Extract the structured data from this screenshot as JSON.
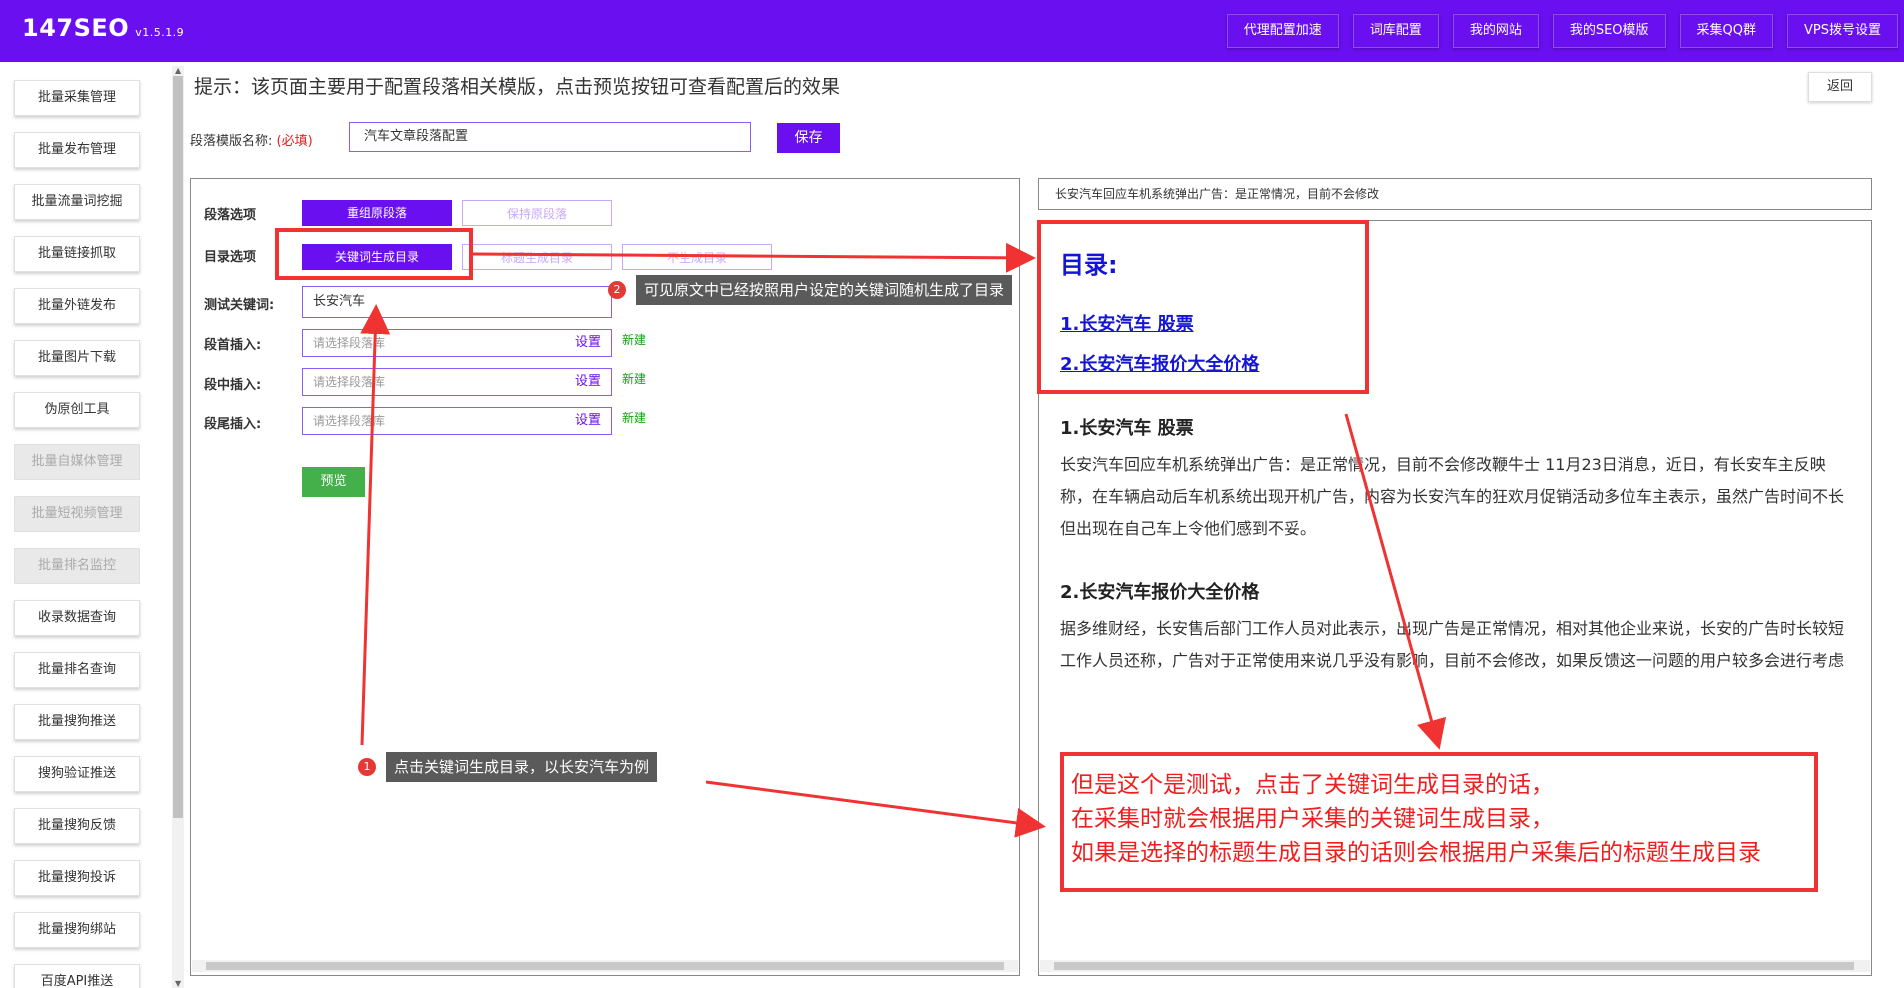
{
  "app": {
    "title": "147SEO",
    "version": "v1.5.1.9"
  },
  "topnav": [
    "代理配置加速",
    "词库配置",
    "我的网站",
    "我的SEO模版",
    "采集QQ群",
    "VPS拨号设置"
  ],
  "sidebar": {
    "items": [
      {
        "label": "批量采集管理",
        "disabled": false
      },
      {
        "label": "批量发布管理",
        "disabled": false
      },
      {
        "label": "批量流量词挖掘",
        "disabled": false
      },
      {
        "label": "批量链接抓取",
        "disabled": false
      },
      {
        "label": "批量外链发布",
        "disabled": false
      },
      {
        "label": "批量图片下载",
        "disabled": false
      },
      {
        "label": "伪原创工具",
        "disabled": false
      },
      {
        "label": "批量自媒体管理",
        "disabled": true
      },
      {
        "label": "批量短视频管理",
        "disabled": true
      },
      {
        "label": "批量排名监控",
        "disabled": true
      },
      {
        "label": "收录数据查询",
        "disabled": false
      },
      {
        "label": "批量排名查询",
        "disabled": false
      },
      {
        "label": "批量搜狗推送",
        "disabled": false
      },
      {
        "label": "搜狗验证推送",
        "disabled": false
      },
      {
        "label": "批量搜狗反馈",
        "disabled": false
      },
      {
        "label": "批量搜狗投诉",
        "disabled": false
      },
      {
        "label": "批量搜狗绑站",
        "disabled": false
      },
      {
        "label": "百度API推送",
        "disabled": false
      }
    ]
  },
  "main": {
    "hint": "提示：该页面主要用于配置段落相关模版，点击预览按钮可查看配置后的效果",
    "back": "返回",
    "template_name_label": "段落模版名称",
    "template_name_required": "(必填)",
    "template_name_value": "汽车文章段落配置",
    "save": "保存"
  },
  "form": {
    "paragraph_label": "段落选项",
    "paragraph_options": [
      "重组原段落",
      "保持原段落"
    ],
    "toc_label": "目录选项",
    "toc_options": [
      "关键词生成目录",
      "标题生成目录",
      "不生成目录"
    ],
    "keyword_label": "测试关键词:",
    "keyword_value": "长安汽车",
    "head_insert_label": "段首插入:",
    "mid_insert_label": "段中插入:",
    "tail_insert_label": "段尾插入:",
    "select_placeholder": "请选择段落库",
    "set_label": "设置",
    "new_label": "新建",
    "preview": "预览"
  },
  "preview": {
    "top_text": "长安汽车回应车机系统弹出广告：是正常情况，目前不会修改",
    "toc_title": "目录:",
    "toc_items": [
      "1.长安汽车 股票",
      "2.长安汽车报价大全价格"
    ],
    "sections": [
      {
        "title": "1.长安汽车 股票",
        "text": "长安汽车回应车机系统弹出广告：是正常情况，目前不会修改鞭牛士 11月23日消息，近日，有长安车主反映称，在车辆启动后车机系统出现开机广告，内容为长安汽车的狂欢月促销活动多位车主表示，虽然广告时间不长但出现在自己车上令他们感到不妥。"
      },
      {
        "title": "2.长安汽车报价大全价格",
        "text": "据多维财经，长安售后部门工作人员对此表示，出现广告是正常情况，相对其他企业来说，长安的广告时长较短工作人员还称，广告对于正常使用来说几乎没有影响，目前不会修改，如果反馈这一问题的用户较多会进行考虑"
      }
    ]
  },
  "annotations": {
    "tip1": {
      "num": "1",
      "text": "点击关键词生成目录，以长安汽车为例"
    },
    "tip2": {
      "num": "2",
      "text": "可见原文中已经按照用户设定的关键词随机生成了目录"
    },
    "note": [
      "但是这个是测试，点击了关键词生成目录的话，",
      "在采集时就会根据用户采集的关键词生成目录，",
      "如果是选择的标题生成目录的话则会根据用户采集后的标题生成目录"
    ],
    "color": "#f03232"
  },
  "colors": {
    "brand": "#6a0ff0",
    "preview_btn": "#43b049",
    "link": "#1515d8",
    "new": "#15a015"
  }
}
